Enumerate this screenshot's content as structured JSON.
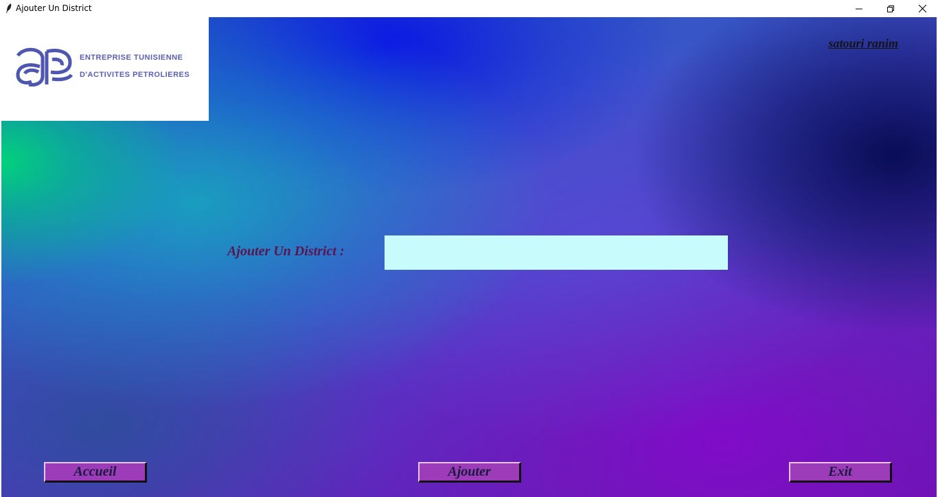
{
  "window": {
    "title": "Ajouter Un District",
    "icon": "feather-icon",
    "controls": [
      "minimize-icon",
      "restore-icon",
      "close-icon"
    ]
  },
  "logo": {
    "line1": "ENTREPRISE TUNISIENNE",
    "line2": "D'ACTIVITES PETROLIERES",
    "brand_color": "#4f56b0"
  },
  "user": {
    "name": "satouri ranim"
  },
  "form": {
    "label": "Ajouter Un District :",
    "value": "",
    "input_bg": "#c8fcfc"
  },
  "buttons": {
    "accueil": "Accueil",
    "ajouter": "Ajouter",
    "exit": "Exit"
  },
  "colors": {
    "button_bg": "#9c3cb8",
    "label_text": "#5a1450"
  }
}
